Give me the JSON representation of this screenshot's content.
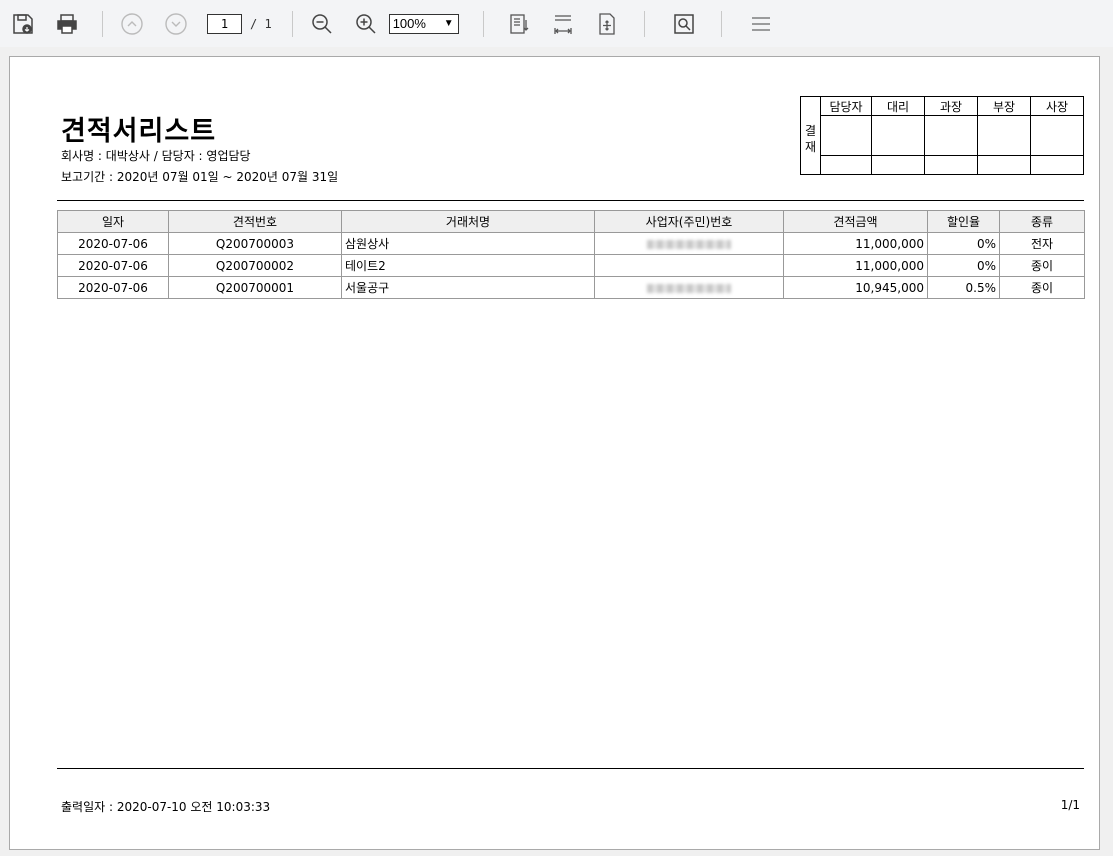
{
  "toolbar": {
    "current_page": "1",
    "total_pages": "/ 1",
    "zoom": "100%"
  },
  "report": {
    "title": "견적서리스트",
    "company_line": "회사명 : 대박상사 / 담당자 : 영업담당",
    "period_line": "보고기간 : 2020년 07월 01일  ~ 2020년 07월 31일",
    "approval": {
      "side_label": "결재",
      "roles": [
        "담당자",
        "대리",
        "과장",
        "부장",
        "사장"
      ]
    },
    "columns": [
      "일자",
      "견적번호",
      "거래처명",
      "사업자(주민)번호",
      "견적금액",
      "할인율",
      "종류"
    ],
    "rows": [
      {
        "date": "2020-07-06",
        "quote_no": "Q200700003",
        "client": "삼원상사",
        "amount": "11,000,000",
        "discount": "0%",
        "kind": "전자"
      },
      {
        "date": "2020-07-06",
        "quote_no": "Q200700002",
        "client": "테이트2",
        "amount": "11,000,000",
        "discount": "0%",
        "kind": "종이"
      },
      {
        "date": "2020-07-06",
        "quote_no": "Q200700001",
        "client": "서울공구",
        "amount": "10,945,000",
        "discount": "0.5%",
        "kind": "종이"
      }
    ],
    "footer": {
      "printed": "출력일자 : 2020-07-10    오전  10:03:33",
      "page": "1/1"
    }
  }
}
